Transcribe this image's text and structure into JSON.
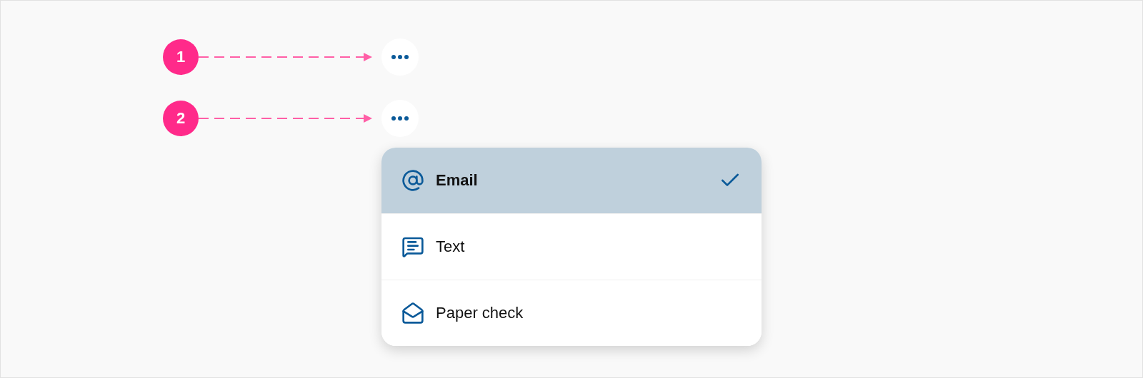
{
  "callouts": [
    {
      "number": "1"
    },
    {
      "number": "2"
    }
  ],
  "menu": {
    "items": [
      {
        "kind": "email",
        "label": "Email",
        "selected": true
      },
      {
        "kind": "text",
        "label": "Text",
        "selected": false
      },
      {
        "kind": "paper",
        "label": "Paper check",
        "selected": false
      }
    ]
  }
}
